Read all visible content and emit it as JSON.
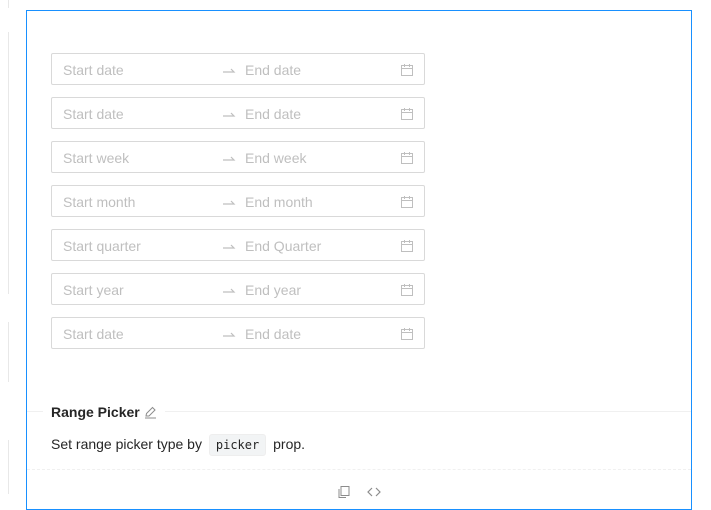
{
  "pickers": [
    {
      "start": "Start date",
      "end": "End date"
    },
    {
      "start": "Start date",
      "end": "End date"
    },
    {
      "start": "Start week",
      "end": "End week"
    },
    {
      "start": "Start month",
      "end": "End month"
    },
    {
      "start": "Start quarter",
      "end": "End Quarter"
    },
    {
      "start": "Start year",
      "end": "End year"
    },
    {
      "start": "Start date",
      "end": "End date"
    }
  ],
  "section": {
    "title": "Range Picker",
    "desc_before": "Set range picker type by",
    "code": "picker",
    "desc_after": "prop."
  },
  "icons": {
    "separator": "swap-right-icon",
    "calendar": "calendar-icon",
    "edit": "edit-icon",
    "copy": "copy-icon",
    "code": "code-icon"
  },
  "colors": {
    "card_border": "#1890ff",
    "input_border": "#d9d9d9",
    "placeholder": "#bfbfbf"
  }
}
